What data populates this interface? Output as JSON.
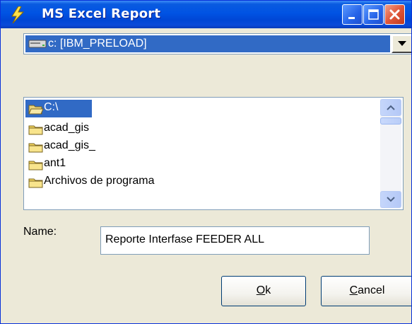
{
  "window": {
    "title": "MS Excel Report"
  },
  "drive_select": {
    "value": "c: [IBM_PRELOAD]"
  },
  "folder_list": {
    "items": [
      {
        "label": "C:\\",
        "selected": true
      },
      {
        "label": "acad_gis",
        "selected": false
      },
      {
        "label": "acad_gis_",
        "selected": false
      },
      {
        "label": "ant1",
        "selected": false
      },
      {
        "label": "Archivos de programa",
        "selected": false
      }
    ]
  },
  "name_field": {
    "label": "Name:",
    "value": "Reporte Interfase FEEDER ALL"
  },
  "buttons": {
    "ok_mnemonic": "O",
    "ok_rest": "k",
    "cancel_mnemonic": "C",
    "cancel_rest": "ancel"
  },
  "colors": {
    "titlebar": "#0053E3",
    "selection": "#316AC5",
    "dialog_bg": "#ECE9D8"
  },
  "icons": {
    "app": "lightning-bolt-icon",
    "drive": "hard-drive-icon",
    "folder": "folder-icon",
    "open_folder": "open-folder-icon"
  }
}
